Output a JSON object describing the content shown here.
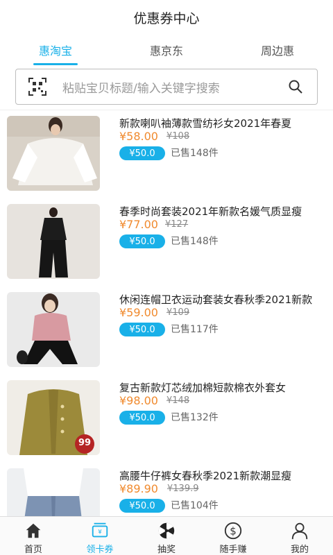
{
  "header": {
    "title": "优惠券中心"
  },
  "tabs": [
    {
      "label": "惠淘宝",
      "active": true
    },
    {
      "label": "惠京东",
      "active": false
    },
    {
      "label": "周边惠",
      "active": false
    }
  ],
  "search": {
    "placeholder": "粘贴宝贝标题/输入关键字搜索"
  },
  "products": [
    {
      "title": "新款喇叭袖薄款雪纺衫女2021年春夏",
      "price": "¥58.00",
      "old_price": "¥108",
      "coupon": "¥50.0",
      "sold": "已售148件"
    },
    {
      "title": "春季时尚套装2021年新款名媛气质显瘦",
      "price": "¥77.00",
      "old_price": "¥127",
      "coupon": "¥50.0",
      "sold": "已售148件"
    },
    {
      "title": "休闲连帽卫衣运动套装女春秋季2021新款",
      "price": "¥59.00",
      "old_price": "¥109",
      "coupon": "¥50.0",
      "sold": "已售117件"
    },
    {
      "title": "复古新款灯芯绒加棉短款棉衣外套女",
      "price": "¥98.00",
      "old_price": "¥148",
      "coupon": "¥50.0",
      "sold": "已售132件",
      "badge": "99"
    },
    {
      "title": "高腰牛仔裤女春秋季2021新款潮显瘦",
      "price": "¥89.90",
      "old_price": "¥139.9",
      "coupon": "¥50.0",
      "sold": "已售104件"
    }
  ],
  "bottom_nav": [
    {
      "label": "首页",
      "icon": "home-icon",
      "active": false
    },
    {
      "label": "领卡券",
      "icon": "coupon-icon",
      "active": true
    },
    {
      "label": "抽奖",
      "icon": "lottery-icon",
      "active": false
    },
    {
      "label": "随手赚",
      "icon": "dollar-icon",
      "active": false
    },
    {
      "label": "我的",
      "icon": "user-icon",
      "active": false
    }
  ],
  "colors": {
    "accent": "#19b0e8",
    "price": "#f08a2e"
  }
}
